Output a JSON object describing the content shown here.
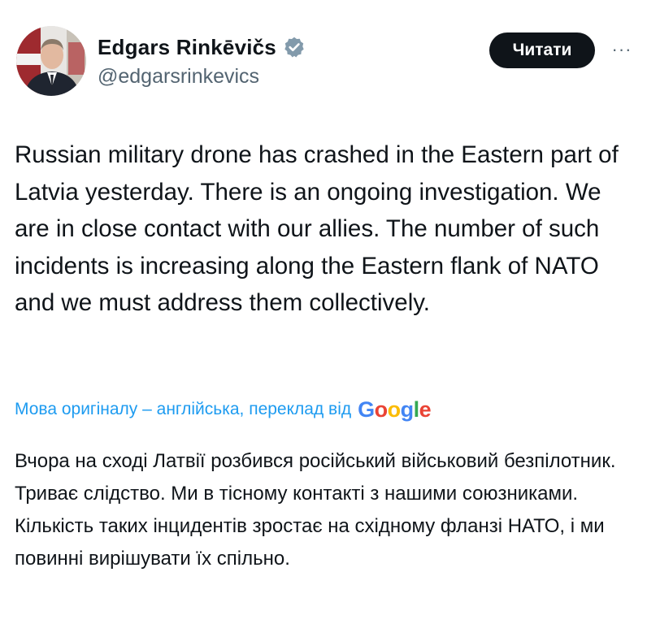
{
  "author": {
    "display_name": "Edgars Rinkēvičs",
    "handle": "@edgarsrinkevics",
    "verified": true
  },
  "actions": {
    "follow_label": "Читати",
    "more_label": "···"
  },
  "tweet": {
    "text": "Russian military drone has crashed in the Eastern part of Latvia yesterday. There is an ongoing investigation. We are in close contact with our allies. The number of such incidents is increasing along the Eastern flank of NATO and we must address them collectively."
  },
  "translation": {
    "notice": "Мова оригіналу – англійська, переклад від",
    "provider": "Google",
    "text": "Вчора на сході Латвії розбився російський військовий безпілотник. Триває слідство. Ми в тісному контакті з нашими союзниками. Кількість таких інцидентів зростає на східному фланзі НАТО, і ми повинні вирішувати їх спільно."
  },
  "colors": {
    "link": "#1d9bf0",
    "button_bg": "#0f1419",
    "secondary_text": "#536471",
    "verified_badge": "#829aab"
  }
}
